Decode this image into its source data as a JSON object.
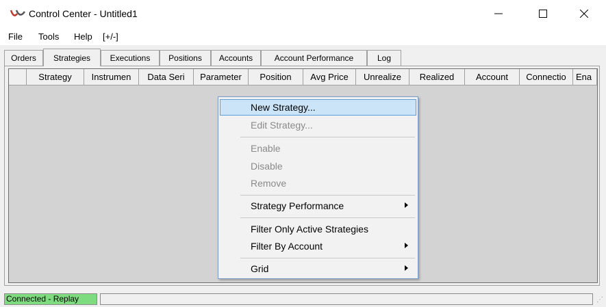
{
  "window": {
    "title": "Control Center - Untitled1",
    "icons": [
      "app-logo-icon",
      "minimize-icon",
      "maximize-icon",
      "close-icon"
    ]
  },
  "menubar": {
    "items": [
      "File",
      "Tools",
      "Help",
      "[+/-]"
    ]
  },
  "tabs": [
    "Orders",
    "Strategies",
    "Executions",
    "Positions",
    "Accounts",
    "Account Performance",
    "Log"
  ],
  "active_tab": "Strategies",
  "grid": {
    "columns": [
      "Strategy",
      "Instrumen",
      "Data Seri",
      "Parameter",
      "Position",
      "Avg Price",
      "Unrealize",
      "Realized",
      "Account",
      "Connectio",
      "Ena"
    ]
  },
  "context_menu": {
    "items": [
      {
        "label": "New Strategy...",
        "state": "highlighted"
      },
      {
        "label": "Edit Strategy...",
        "state": "disabled"
      },
      {
        "label": "Enable",
        "state": "disabled"
      },
      {
        "label": "Disable",
        "state": "disabled"
      },
      {
        "label": "Remove",
        "state": "disabled"
      },
      {
        "label": "Strategy Performance",
        "state": "enabled",
        "submenu": true
      },
      {
        "label": "Filter Only Active Strategies",
        "state": "enabled"
      },
      {
        "label": "Filter By Account",
        "state": "enabled",
        "submenu": true
      },
      {
        "label": "Grid",
        "state": "enabled",
        "submenu": true
      }
    ]
  },
  "status": {
    "connection": "Connected - Replay",
    "connection_color": "#7fdb7f"
  },
  "colors": {
    "highlight_bg": "#cce4f7",
    "highlight_border": "#5c9ed6",
    "disabled_text": "#8a8a8a"
  }
}
